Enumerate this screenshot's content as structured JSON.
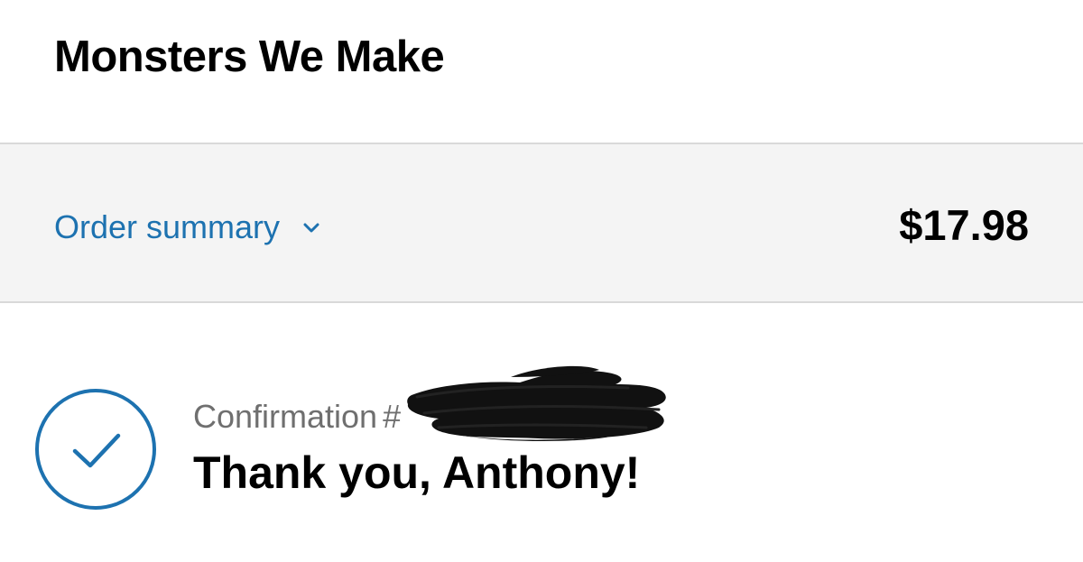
{
  "shop": {
    "name": "Monsters We Make"
  },
  "order_summary": {
    "label": "Order summary",
    "toggle_icon": "chevron-down-icon",
    "total": "$17.98"
  },
  "confirmation": {
    "status_icon": "check-circle-icon",
    "label": "Confirmation",
    "number_prefix": "#",
    "number_redacted": true,
    "heading": "Thank you, Anthony!"
  },
  "colors": {
    "accent": "#1d72b0",
    "summary_background": "#f4f4f4",
    "divider": "#d9d9d9",
    "muted_text": "#6f6f6f",
    "redaction": "#111111"
  }
}
